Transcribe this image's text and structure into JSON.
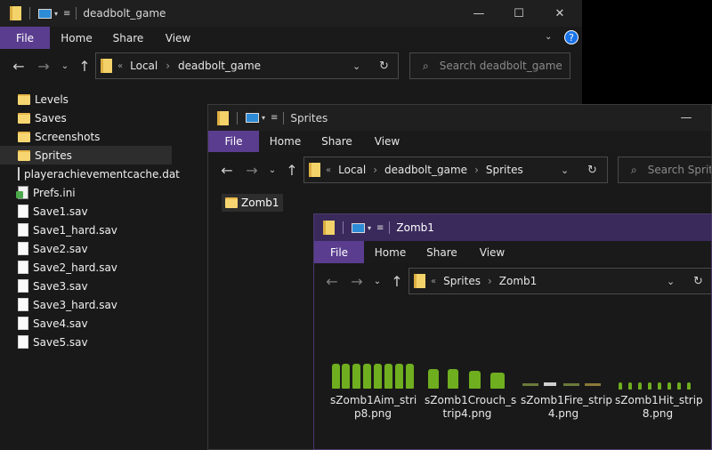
{
  "win1": {
    "title": "deadbolt_game",
    "ribbon": {
      "file": "File",
      "home": "Home",
      "share": "Share",
      "view": "View"
    },
    "breadcrumb": [
      "Local",
      "deadbolt_game"
    ],
    "breadcrumb_overflow": "«",
    "search_placeholder": "Search deadbolt_game",
    "items": [
      {
        "label": "Levels",
        "icon": "folder-icon"
      },
      {
        "label": "Saves",
        "icon": "folder-icon"
      },
      {
        "label": "Screenshots",
        "icon": "folder-icon"
      },
      {
        "label": "Sprites",
        "icon": "folder-icon"
      },
      {
        "label": "playerachievementcache.dat",
        "icon": "file-icon"
      },
      {
        "label": "Prefs.ini",
        "icon": "ini-file-icon"
      },
      {
        "label": "Save1.sav",
        "icon": "file-icon"
      },
      {
        "label": "Save1_hard.sav",
        "icon": "file-icon"
      },
      {
        "label": "Save2.sav",
        "icon": "file-icon"
      },
      {
        "label": "Save2_hard.sav",
        "icon": "file-icon"
      },
      {
        "label": "Save3.sav",
        "icon": "file-icon"
      },
      {
        "label": "Save3_hard.sav",
        "icon": "file-icon"
      },
      {
        "label": "Save4.sav",
        "icon": "file-icon"
      },
      {
        "label": "Save5.sav",
        "icon": "file-icon"
      }
    ]
  },
  "win2": {
    "title": "Sprites",
    "ribbon": {
      "file": "File",
      "home": "Home",
      "share": "Share",
      "view": "View"
    },
    "breadcrumb": [
      "Local",
      "deadbolt_game",
      "Sprites"
    ],
    "breadcrumb_overflow": "«",
    "search_placeholder": "Search Sprite",
    "items": [
      {
        "label": "Zomb1",
        "icon": "folder-icon"
      }
    ]
  },
  "win3": {
    "title": "Zomb1",
    "ribbon": {
      "file": "File",
      "home": "Home",
      "share": "Share",
      "view": "View"
    },
    "breadcrumb": [
      "Sprites",
      "Zomb1"
    ],
    "breadcrumb_overflow": "«",
    "files": [
      {
        "line1": "sZomb1Aim_stri",
        "line2": "p8.png"
      },
      {
        "line1": "sZomb1Crouch_s",
        "line2": "trip4.png"
      },
      {
        "line1": "sZomb1Fire_strip",
        "line2": "4.png"
      },
      {
        "line1": "sZomb1Hit_strip",
        "line2": "8.png"
      }
    ]
  },
  "colors": {
    "file_tab": "#5a3d8f",
    "win3_titlebar": "#3a2a5c",
    "help": "#1a73e8"
  }
}
